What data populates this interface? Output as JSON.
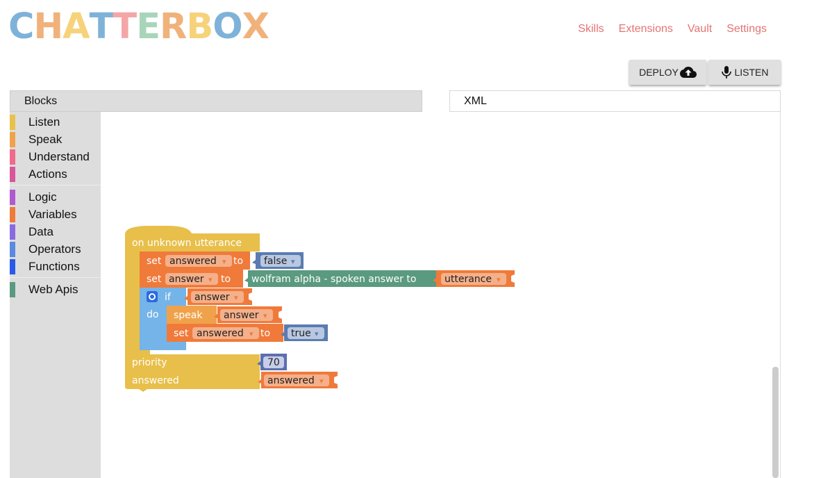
{
  "app": {
    "logo_letters": [
      {
        "ch": "C",
        "color": "#7fb2d8"
      },
      {
        "ch": "H",
        "color": "#f0b27a"
      },
      {
        "ch": "A",
        "color": "#f6d27a"
      },
      {
        "ch": "T",
        "color": "#7fb2d8"
      },
      {
        "ch": "T",
        "color": "#f4a6a6"
      },
      {
        "ch": "E",
        "color": "#a8d5ba"
      },
      {
        "ch": "R",
        "color": "#f0b27a"
      },
      {
        "ch": "B",
        "color": "#f6d27a"
      },
      {
        "ch": "O",
        "color": "#7fb2d8"
      },
      {
        "ch": "X",
        "color": "#f0b27a"
      }
    ]
  },
  "nav": {
    "items": [
      "Skills",
      "Extensions",
      "Vault",
      "Settings"
    ],
    "color": "#e57373"
  },
  "toolbar": {
    "deploy_label": "DEPLOY",
    "listen_label": "LISTEN"
  },
  "tabs": {
    "blocks": "Blocks",
    "xml": "XML"
  },
  "toolbox": {
    "groups": [
      [
        {
          "label": "Listen",
          "color": "#e8c14a"
        },
        {
          "label": "Speak",
          "color": "#f0a24a"
        },
        {
          "label": "Understand",
          "color": "#f06a8a"
        },
        {
          "label": "Actions",
          "color": "#d9569a"
        }
      ],
      [
        {
          "label": "Logic",
          "color": "#b05ad0"
        },
        {
          "label": "Variables",
          "color": "#f07a3a"
        },
        {
          "label": "Data",
          "color": "#8a6ae0"
        },
        {
          "label": "Operators",
          "color": "#5a8ae0"
        },
        {
          "label": "Functions",
          "color": "#2a5ae8"
        }
      ],
      [
        {
          "label": "Web Apis",
          "color": "#5a9a80"
        }
      ]
    ]
  },
  "blocks": {
    "event_label": "on unknown utterance",
    "set1": {
      "kw": "set",
      "var": "answered",
      "to": "to",
      "val": "false"
    },
    "set2": {
      "kw": "set",
      "var": "answer",
      "to": "to",
      "fn": "wolfram alpha - spoken answer to",
      "arg": "utterance"
    },
    "if_kw": "if",
    "if_var": "answer",
    "do_kw": "do",
    "speak": {
      "kw": "speak",
      "var": "answer"
    },
    "set3": {
      "kw": "set",
      "var": "answered",
      "to": "to",
      "val": "true"
    },
    "priority_label": "priority",
    "priority_value": "70",
    "answered_label": "answered",
    "answered_var": "answered",
    "colors": {
      "event": "#e8bf4a",
      "variable": "#f07a3a",
      "logic": "#5b7cb0",
      "webapi": "#5a9a80",
      "control": "#74b4e8",
      "speak": "#f0a24a",
      "number": "#5b6fb0"
    },
    "dropdown_arrow": "▾"
  }
}
